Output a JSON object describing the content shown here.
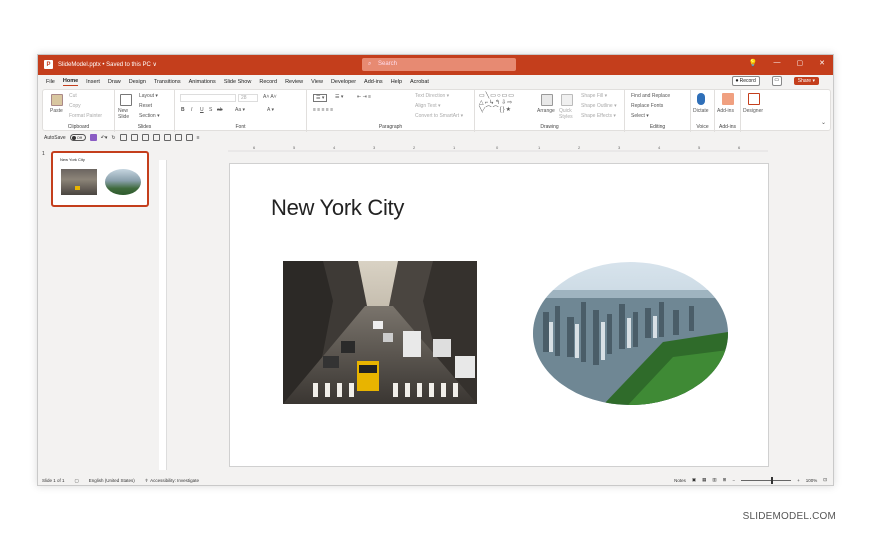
{
  "titlebar": {
    "logo": "P",
    "doc_title": "SlideModel.pptx • Saved to this PC ∨",
    "search_placeholder": "Search",
    "controls": [
      "💡",
      "—",
      "▢",
      "✕"
    ]
  },
  "tabs": [
    "File",
    "Home",
    "Insert",
    "Draw",
    "Design",
    "Transitions",
    "Animations",
    "Slide Show",
    "Record",
    "Review",
    "View",
    "Developer",
    "Add-ins",
    "Help",
    "Acrobat"
  ],
  "tab_actions": {
    "record": "⏺ Record",
    "share": "Share ▾"
  },
  "ribbon": {
    "clipboard": {
      "label": "Clipboard",
      "paste": "Paste",
      "cut": "Cut",
      "copy": "Copy",
      "format_painter": "Format Painter"
    },
    "slides": {
      "label": "Slides",
      "new_slide": "New Slide",
      "layout": "Layout ▾",
      "reset": "Reset",
      "section": "Section ▾"
    },
    "font": {
      "label": "Font",
      "size": "28"
    },
    "paragraph": {
      "label": "Paragraph",
      "text_direction": "Text Direction ▾",
      "align_text": "Align Text ▾",
      "smartart": "Convert to SmartArt ▾"
    },
    "drawing": {
      "label": "Drawing",
      "arrange": "Arrange",
      "quick_styles": "Quick Styles",
      "shape_fill": "Shape Fill ▾",
      "shape_outline": "Shape Outline ▾",
      "shape_effects": "Shape Effects ▾"
    },
    "editing": {
      "label": "Editing",
      "find_replace": "Find and Replace",
      "replace_fonts": "Replace Fonts",
      "select": "Select ▾"
    },
    "voice": {
      "label": "Voice",
      "dictate": "Dictate"
    },
    "addins": {
      "label": "Add-ins",
      "addins_btn": "Add-ins"
    },
    "designer": {
      "designer_btn": "Designer"
    }
  },
  "qat": {
    "autosave": "AutoSave",
    "toggle": "Off"
  },
  "thumbnails": [
    {
      "number": "1",
      "title": "New York City"
    }
  ],
  "ruler_marks": [
    "6",
    "5",
    "4",
    "3",
    "2",
    "1",
    "0",
    "1",
    "2",
    "3",
    "4",
    "5",
    "6"
  ],
  "slide": {
    "title": "New York City"
  },
  "statusbar": {
    "slide_count": "Slide 1 of 1",
    "language": "English (United States)",
    "accessibility": "Accessibility: Investigate",
    "notes": "Notes",
    "zoom": "100%"
  },
  "watermark": "SLIDEMODEL.COM",
  "colors": {
    "accent": "#c43e1c",
    "ribbon_bg": "#ffffff",
    "window_bg": "#f3f2f1"
  }
}
